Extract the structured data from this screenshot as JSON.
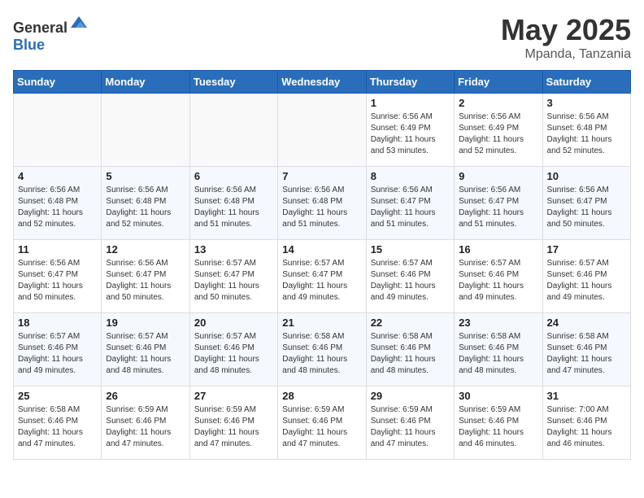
{
  "header": {
    "logo": {
      "text_general": "General",
      "text_blue": "Blue"
    },
    "title": "May 2025",
    "location": "Mpanda, Tanzania"
  },
  "days_of_week": [
    "Sunday",
    "Monday",
    "Tuesday",
    "Wednesday",
    "Thursday",
    "Friday",
    "Saturday"
  ],
  "weeks": [
    [
      {
        "day": "",
        "info": ""
      },
      {
        "day": "",
        "info": ""
      },
      {
        "day": "",
        "info": ""
      },
      {
        "day": "",
        "info": ""
      },
      {
        "day": "1",
        "sunrise": "6:56 AM",
        "sunset": "6:49 PM",
        "daylight": "11 hours and 53 minutes."
      },
      {
        "day": "2",
        "sunrise": "6:56 AM",
        "sunset": "6:49 PM",
        "daylight": "11 hours and 52 minutes."
      },
      {
        "day": "3",
        "sunrise": "6:56 AM",
        "sunset": "6:48 PM",
        "daylight": "11 hours and 52 minutes."
      }
    ],
    [
      {
        "day": "4",
        "sunrise": "6:56 AM",
        "sunset": "6:48 PM",
        "daylight": "11 hours and 52 minutes."
      },
      {
        "day": "5",
        "sunrise": "6:56 AM",
        "sunset": "6:48 PM",
        "daylight": "11 hours and 52 minutes."
      },
      {
        "day": "6",
        "sunrise": "6:56 AM",
        "sunset": "6:48 PM",
        "daylight": "11 hours and 51 minutes."
      },
      {
        "day": "7",
        "sunrise": "6:56 AM",
        "sunset": "6:48 PM",
        "daylight": "11 hours and 51 minutes."
      },
      {
        "day": "8",
        "sunrise": "6:56 AM",
        "sunset": "6:47 PM",
        "daylight": "11 hours and 51 minutes."
      },
      {
        "day": "9",
        "sunrise": "6:56 AM",
        "sunset": "6:47 PM",
        "daylight": "11 hours and 51 minutes."
      },
      {
        "day": "10",
        "sunrise": "6:56 AM",
        "sunset": "6:47 PM",
        "daylight": "11 hours and 50 minutes."
      }
    ],
    [
      {
        "day": "11",
        "sunrise": "6:56 AM",
        "sunset": "6:47 PM",
        "daylight": "11 hours and 50 minutes."
      },
      {
        "day": "12",
        "sunrise": "6:56 AM",
        "sunset": "6:47 PM",
        "daylight": "11 hours and 50 minutes."
      },
      {
        "day": "13",
        "sunrise": "6:57 AM",
        "sunset": "6:47 PM",
        "daylight": "11 hours and 50 minutes."
      },
      {
        "day": "14",
        "sunrise": "6:57 AM",
        "sunset": "6:47 PM",
        "daylight": "11 hours and 49 minutes."
      },
      {
        "day": "15",
        "sunrise": "6:57 AM",
        "sunset": "6:46 PM",
        "daylight": "11 hours and 49 minutes."
      },
      {
        "day": "16",
        "sunrise": "6:57 AM",
        "sunset": "6:46 PM",
        "daylight": "11 hours and 49 minutes."
      },
      {
        "day": "17",
        "sunrise": "6:57 AM",
        "sunset": "6:46 PM",
        "daylight": "11 hours and 49 minutes."
      }
    ],
    [
      {
        "day": "18",
        "sunrise": "6:57 AM",
        "sunset": "6:46 PM",
        "daylight": "11 hours and 49 minutes."
      },
      {
        "day": "19",
        "sunrise": "6:57 AM",
        "sunset": "6:46 PM",
        "daylight": "11 hours and 48 minutes."
      },
      {
        "day": "20",
        "sunrise": "6:57 AM",
        "sunset": "6:46 PM",
        "daylight": "11 hours and 48 minutes."
      },
      {
        "day": "21",
        "sunrise": "6:58 AM",
        "sunset": "6:46 PM",
        "daylight": "11 hours and 48 minutes."
      },
      {
        "day": "22",
        "sunrise": "6:58 AM",
        "sunset": "6:46 PM",
        "daylight": "11 hours and 48 minutes."
      },
      {
        "day": "23",
        "sunrise": "6:58 AM",
        "sunset": "6:46 PM",
        "daylight": "11 hours and 48 minutes."
      },
      {
        "day": "24",
        "sunrise": "6:58 AM",
        "sunset": "6:46 PM",
        "daylight": "11 hours and 47 minutes."
      }
    ],
    [
      {
        "day": "25",
        "sunrise": "6:58 AM",
        "sunset": "6:46 PM",
        "daylight": "11 hours and 47 minutes."
      },
      {
        "day": "26",
        "sunrise": "6:59 AM",
        "sunset": "6:46 PM",
        "daylight": "11 hours and 47 minutes."
      },
      {
        "day": "27",
        "sunrise": "6:59 AM",
        "sunset": "6:46 PM",
        "daylight": "11 hours and 47 minutes."
      },
      {
        "day": "28",
        "sunrise": "6:59 AM",
        "sunset": "6:46 PM",
        "daylight": "11 hours and 47 minutes."
      },
      {
        "day": "29",
        "sunrise": "6:59 AM",
        "sunset": "6:46 PM",
        "daylight": "11 hours and 47 minutes."
      },
      {
        "day": "30",
        "sunrise": "6:59 AM",
        "sunset": "6:46 PM",
        "daylight": "11 hours and 46 minutes."
      },
      {
        "day": "31",
        "sunrise": "7:00 AM",
        "sunset": "6:46 PM",
        "daylight": "11 hours and 46 minutes."
      }
    ]
  ]
}
